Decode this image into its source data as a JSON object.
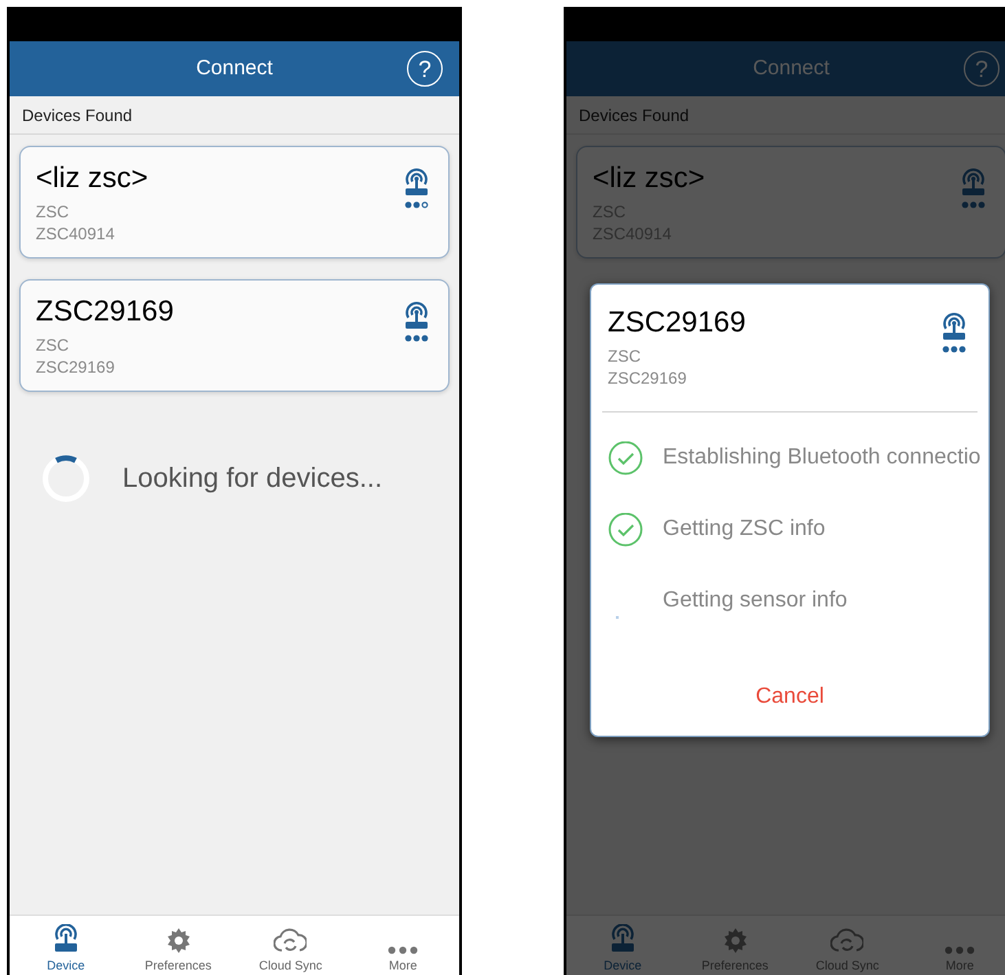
{
  "screens": [
    {
      "header": {
        "title": "Connect",
        "help": "?"
      },
      "section_title": "Devices Found",
      "devices": [
        {
          "name": "<liz zsc>",
          "type": "ZSC",
          "serial": "ZSC40914",
          "kind": "weaker"
        },
        {
          "name": "ZSC29169",
          "type": "ZSC",
          "serial": "ZSC29169",
          "kind": "stronger"
        }
      ],
      "status": "Looking for devices...",
      "tabs": [
        {
          "label": "Device",
          "selected": true,
          "kind": "device"
        },
        {
          "label": "Preferences",
          "selected": false,
          "kind": "gear"
        },
        {
          "label": "Cloud Sync",
          "selected": false,
          "kind": "cloud"
        },
        {
          "label": "More",
          "selected": false,
          "kind": "more"
        }
      ]
    },
    {
      "header": {
        "title": "Connect",
        "help": "?"
      },
      "section_title": "Devices Found",
      "devices": [
        {
          "name": "<liz zsc>",
          "type": "ZSC",
          "serial": "ZSC40914",
          "kind": "stronger"
        }
      ],
      "dialog": {
        "device": {
          "name": "ZSC29169",
          "type": "ZSC",
          "serial": "ZSC29169",
          "kind": "stronger"
        },
        "steps": [
          {
            "label": "Establishing Bluetooth connectio",
            "done": true
          },
          {
            "label": "Getting ZSC info",
            "done": true
          },
          {
            "label": "Getting sensor info",
            "done": false
          }
        ],
        "cancel": "Cancel"
      },
      "tabs": [
        {
          "label": "Device",
          "selected": true,
          "kind": "device"
        },
        {
          "label": "Preferences",
          "selected": false,
          "kind": "gear"
        },
        {
          "label": "Cloud Sync",
          "selected": false,
          "kind": "cloud"
        },
        {
          "label": "More",
          "selected": false,
          "kind": "more"
        }
      ]
    }
  ]
}
